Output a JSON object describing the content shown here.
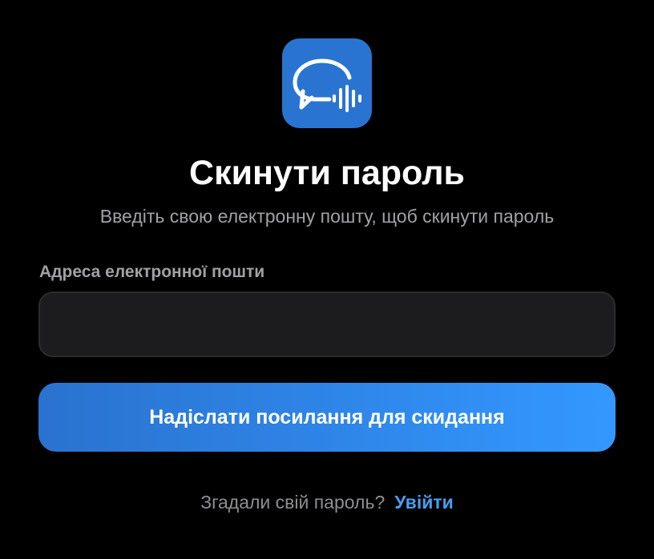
{
  "app": {
    "logo_icon": "chat-bubble-soundwave-icon",
    "logo_color": "#2a74d1"
  },
  "header": {
    "title": "Скинути пароль",
    "subtitle": "Введіть свою електронну пошту, щоб скинути пароль"
  },
  "form": {
    "email_label": "Адреса електронної пошти",
    "email_value": "",
    "submit_label": "Надіслати посилання для скидання",
    "submit_gradient": [
      "#2a72cf",
      "#3398ff"
    ]
  },
  "footer": {
    "prompt": "Згадали свій пароль?",
    "signin_label": "Увійти",
    "link_color": "#4a9df0"
  }
}
